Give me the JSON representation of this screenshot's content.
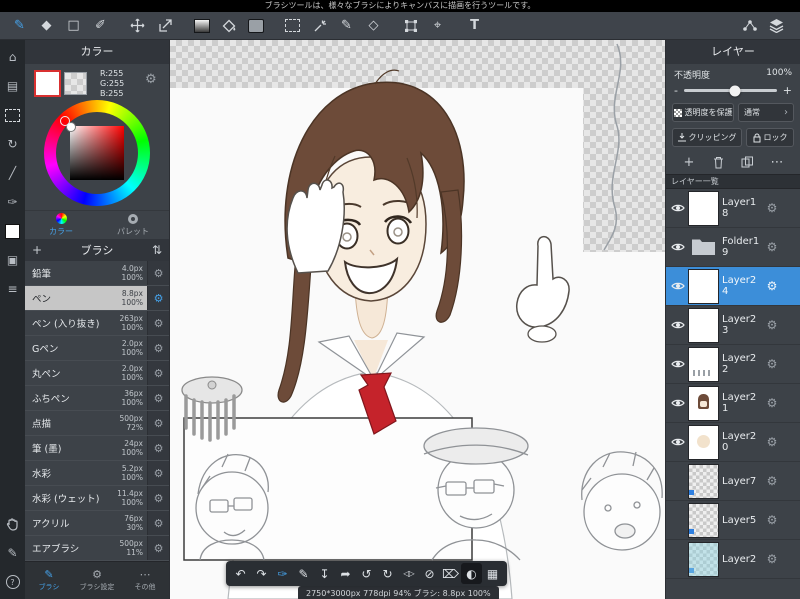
{
  "topbar": {
    "tooltip": "ブラシツールは、様々なブラシによりキャンバスに描画を行うツールです。"
  },
  "colors": {
    "accent": "#45a1e8",
    "selected_layer": "#3c8ed9",
    "tie_red": "#c5232b",
    "hair_brown": "#6d4b39"
  },
  "toolbar": {
    "tools": [
      {
        "name": "brush-tool",
        "active": true
      },
      {
        "name": "eraser-tool"
      },
      {
        "name": "square-tool"
      },
      {
        "name": "dot-pen-tool"
      },
      {
        "name": "move-tool"
      },
      {
        "name": "share-canvas-tool"
      },
      {
        "name": "gradient-tool"
      },
      {
        "name": "bucket-tool"
      },
      {
        "name": "solid-chip-tool"
      },
      {
        "name": "select-rect-tool"
      },
      {
        "name": "magic-wand-tool"
      },
      {
        "name": "select-pen-tool"
      },
      {
        "name": "select-eraser-tool"
      },
      {
        "name": "transform-tool"
      },
      {
        "name": "auto-select-tool"
      },
      {
        "name": "text-tool"
      }
    ],
    "right_tools": [
      {
        "name": "cloud-icon"
      },
      {
        "name": "layers-panel-icon"
      }
    ]
  },
  "left_rail": {
    "top_icons": [
      "gallery-icon",
      "pages-icon",
      "select-area-icon",
      "rotate-view-icon",
      "ruler-icon",
      "material-icon",
      "fg-color-icon",
      "panel-toggle-icon",
      "list-toggle-icon"
    ],
    "bottom_icons": [
      "hand-icon",
      "pen-cursor-icon",
      "help-icon"
    ]
  },
  "color_panel": {
    "title": "カラー",
    "rgb": [
      "R:255",
      "G:255",
      "B:255"
    ],
    "tabs": [
      {
        "label": "カラー",
        "active": true
      },
      {
        "label": "パレット"
      }
    ],
    "brush_header": {
      "title": "ブラシ",
      "add": "+",
      "sort": "⇅"
    },
    "brushes": [
      {
        "name": "鉛筆",
        "size": "4.0px",
        "opacity": "100%"
      },
      {
        "name": "ペン",
        "size": "8.8px",
        "opacity": "100%",
        "selected": true
      },
      {
        "name": "ペン (入り抜き)",
        "size": "263px",
        "opacity": "100%"
      },
      {
        "name": "Gペン",
        "size": "2.0px",
        "opacity": "100%"
      },
      {
        "name": "丸ペン",
        "size": "2.0px",
        "opacity": "100%"
      },
      {
        "name": "ふちペン",
        "size": "36px",
        "opacity": "100%"
      },
      {
        "name": "点描",
        "size": "500px",
        "opacity": "72%"
      },
      {
        "name": "筆 (墨)",
        "size": "24px",
        "opacity": "100%"
      },
      {
        "name": "水彩",
        "size": "5.2px",
        "opacity": "100%"
      },
      {
        "name": "水彩 (ウェット)",
        "size": "11.4px",
        "opacity": "100%"
      },
      {
        "name": "アクリル",
        "size": "76px",
        "opacity": "30%"
      },
      {
        "name": "エアブラシ",
        "size": "500px",
        "opacity": "11%"
      }
    ],
    "bottom_tabs": [
      {
        "label": "ブラシ",
        "active": true
      },
      {
        "label": "ブラシ設定"
      },
      {
        "label": "その他"
      }
    ]
  },
  "canvas": {
    "status": "2750*3000px 778dpi 94% ブラシ: 8.8px 100%",
    "quickbar": [
      "undo-icon",
      "redo-icon",
      "snap-icon",
      "draw-icon",
      "save-icon",
      "export-icon",
      "rotate-ccw-icon",
      "rotate-cw-icon",
      "flip-icon",
      "no-draw-icon",
      "clear-icon",
      "invert-icon",
      "grid-icon"
    ]
  },
  "layers_panel": {
    "title": "レイヤー",
    "opacity_label": "不透明度",
    "opacity_value": "100%",
    "minus": "-",
    "plus": "+",
    "protect_label": "透明度を保護",
    "blend_label": "通常",
    "clipping_label": "クリッピング",
    "lock_label": "ロック",
    "actions": [
      "add-layer-icon",
      "delete-layer-icon",
      "duplicate-layer-icon",
      "more-icon"
    ],
    "list_label": "レイヤー一覧",
    "layers": [
      {
        "name": "Layer18",
        "visible": true,
        "thumb": "white"
      },
      {
        "name": "Folder19",
        "visible": true,
        "thumb": "folder"
      },
      {
        "name": "Layer24",
        "visible": true,
        "selected": true,
        "thumb": "white"
      },
      {
        "name": "Layer23",
        "visible": true,
        "thumb": "white"
      },
      {
        "name": "Layer22",
        "visible": true,
        "thumb": "marks"
      },
      {
        "name": "Layer21",
        "visible": true,
        "thumb": "figure"
      },
      {
        "name": "Layer20",
        "visible": true,
        "thumb": "beige"
      },
      {
        "name": "Layer7",
        "visible": false,
        "thumb": "checker"
      },
      {
        "name": "Layer5",
        "visible": false,
        "thumb": "checker"
      },
      {
        "name": "Layer2",
        "visible": false,
        "thumb": "checker-cyan"
      }
    ]
  }
}
